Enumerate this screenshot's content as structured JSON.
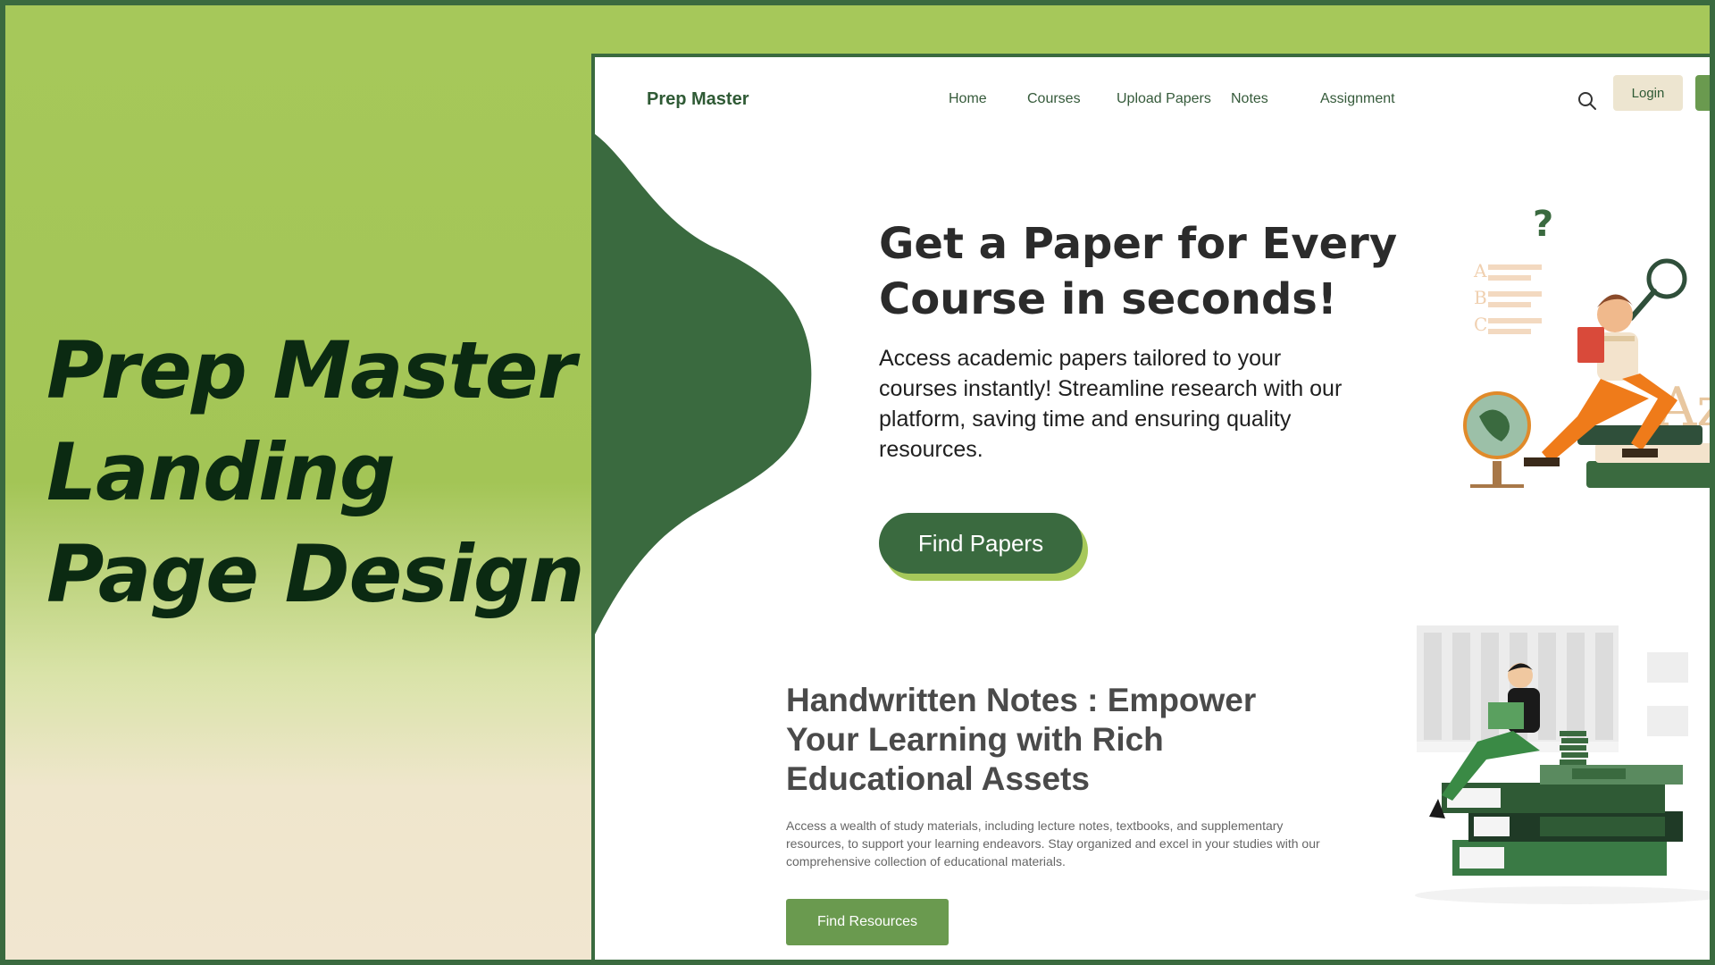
{
  "poster": {
    "title_lines": [
      "Prep Master",
      "Landing",
      "Page Design"
    ]
  },
  "site": {
    "brand": "Prep Master",
    "nav": [
      "Home",
      "Courses",
      "Upload  Papers",
      "Notes",
      "Assignment"
    ],
    "login_label": "Login",
    "search_icon": "search-icon"
  },
  "hero": {
    "title_lines": [
      "Get a Paper for Every",
      "Course  in  seconds!"
    ],
    "description": "Access academic papers tailored to your courses instantly! Streamline research with our platform, saving time and ensuring quality resources.",
    "button": "Find Papers",
    "illustration_letters": [
      "?",
      "A",
      "B",
      "C",
      "Az"
    ]
  },
  "notes": {
    "title_lines": [
      "Handwritten Notes : Empower",
      "Your Learning with Rich",
      "Educational Assets"
    ],
    "description": "Access a wealth of study materials, including lecture notes, textbooks, and supplementary resources, to support your learning endeavors. Stay organized and excel in your studies with our comprehensive collection of educational materials.",
    "button": "Find Resources"
  },
  "colors": {
    "dark_green": "#3a6a3f",
    "light_green": "#a6c85a",
    "mid_green": "#6a9a4f",
    "beige": "#ede5d0",
    "text_dark": "#0b2a12"
  }
}
